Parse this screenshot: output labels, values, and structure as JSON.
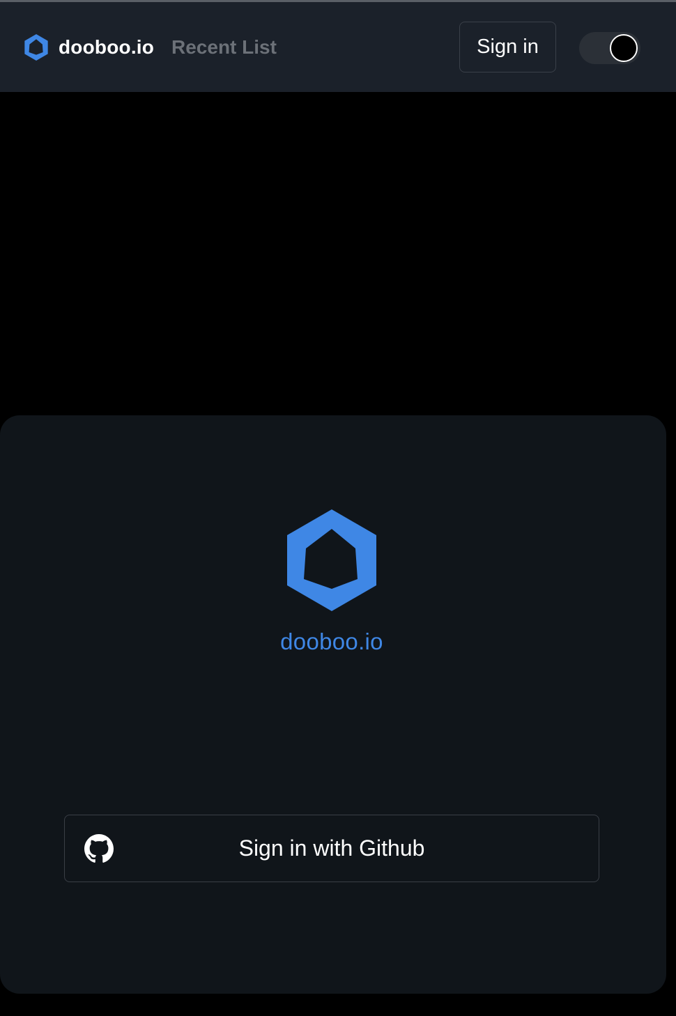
{
  "header": {
    "brand_name": "dooboo.io",
    "nav_link": "Recent List",
    "sign_in_label": "Sign in",
    "theme_toggle_state": "off"
  },
  "card": {
    "logo_text": "dooboo.io",
    "github_button_label": "Sign in with Github"
  },
  "colors": {
    "accent": "#3f87e5",
    "header_bg": "#1b212a",
    "card_bg": "#10151a",
    "page_bg": "#000000"
  },
  "icons": {
    "brand": "hexagon-logo-icon",
    "github": "github-icon"
  }
}
